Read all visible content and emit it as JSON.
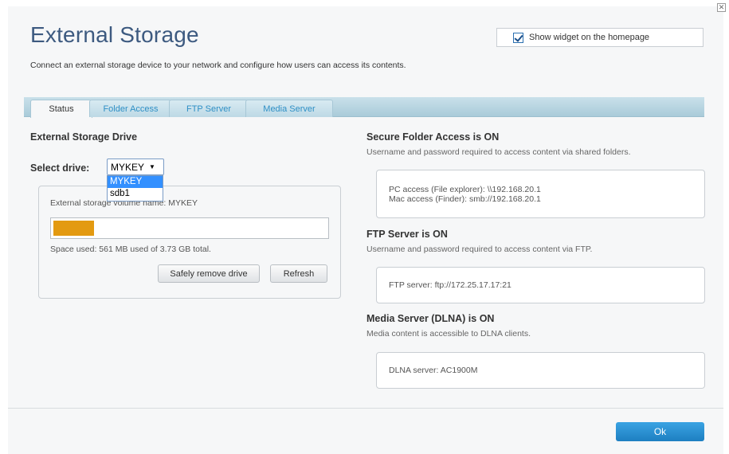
{
  "header": {
    "title": "External Storage",
    "subtitle": "Connect an external storage device to your network and configure how users can access its contents.",
    "widget_label": "Show widget on the homepage",
    "widget_checked": true,
    "close_glyph": "✕"
  },
  "tabs": [
    {
      "label": "Status",
      "active": true
    },
    {
      "label": "Folder Access",
      "active": false
    },
    {
      "label": "FTP Server",
      "active": false
    },
    {
      "label": "Media Server",
      "active": false
    }
  ],
  "drive": {
    "heading": "External Storage Drive",
    "select_label": "Select drive:",
    "selected": "MYKEY",
    "options": [
      "MYKEY",
      "sdb1"
    ],
    "volume_name": "External storage volume name: MYKEY",
    "used_fraction": 0.15,
    "space_text": "Space used: 561 MB used of 3.73 GB total.",
    "safely_remove_label": "Safely remove drive",
    "refresh_label": "Refresh"
  },
  "secure_folder": {
    "heading": "Secure Folder Access is ON",
    "desc": "Username and password required to access content via shared folders.",
    "pc_access": "PC access (File explorer): \\\\192.168.20.1",
    "mac_access": "Mac access (Finder): smb://192.168.20.1"
  },
  "ftp": {
    "heading": "FTP Server is ON",
    "desc": "Username and password required to access content via FTP.",
    "server": "FTP server: ftp://172.25.17.17:21"
  },
  "media": {
    "heading": "Media Server (DLNA) is ON",
    "desc": "Media content is accessible to DLNA clients.",
    "server": "DLNA server: AC1900M"
  },
  "footer": {
    "ok_label": "Ok"
  },
  "colors": {
    "title": "#3d5a80",
    "accent": "#1d7fc1",
    "usage_bar": "#e39a11"
  }
}
